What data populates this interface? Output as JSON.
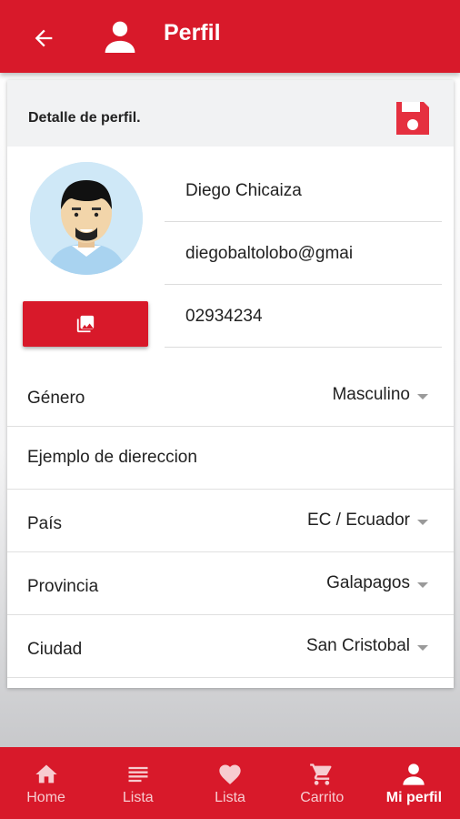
{
  "appbar": {
    "title": "Perfil"
  },
  "card": {
    "header_label": "Detalle de perfil.",
    "fields": {
      "name": "Diego Chicaiza",
      "email": "diegobaltolobo@gmai",
      "phone": "02934234"
    },
    "rows": [
      {
        "label": "Género",
        "value": "Masculino"
      },
      {
        "label": "Ejemplo de diereccion",
        "value": ""
      },
      {
        "label": "País",
        "value": "EC / Ecuador"
      },
      {
        "label": "Provincia",
        "value": "Galapagos"
      },
      {
        "label": "Ciudad",
        "value": "San Cristobal"
      }
    ]
  },
  "nav": [
    {
      "label": "Home",
      "icon": "home-icon"
    },
    {
      "label": "Lista",
      "icon": "list-icon"
    },
    {
      "label": "Lista",
      "icon": "heart-icon"
    },
    {
      "label": "Carrito",
      "icon": "cart-icon"
    },
    {
      "label": "Mi perfil",
      "icon": "person-icon"
    }
  ],
  "colors": {
    "primary": "#d8192a",
    "header_bg": "#f1f2f3",
    "avatar_bg": "#cfe8f7"
  }
}
